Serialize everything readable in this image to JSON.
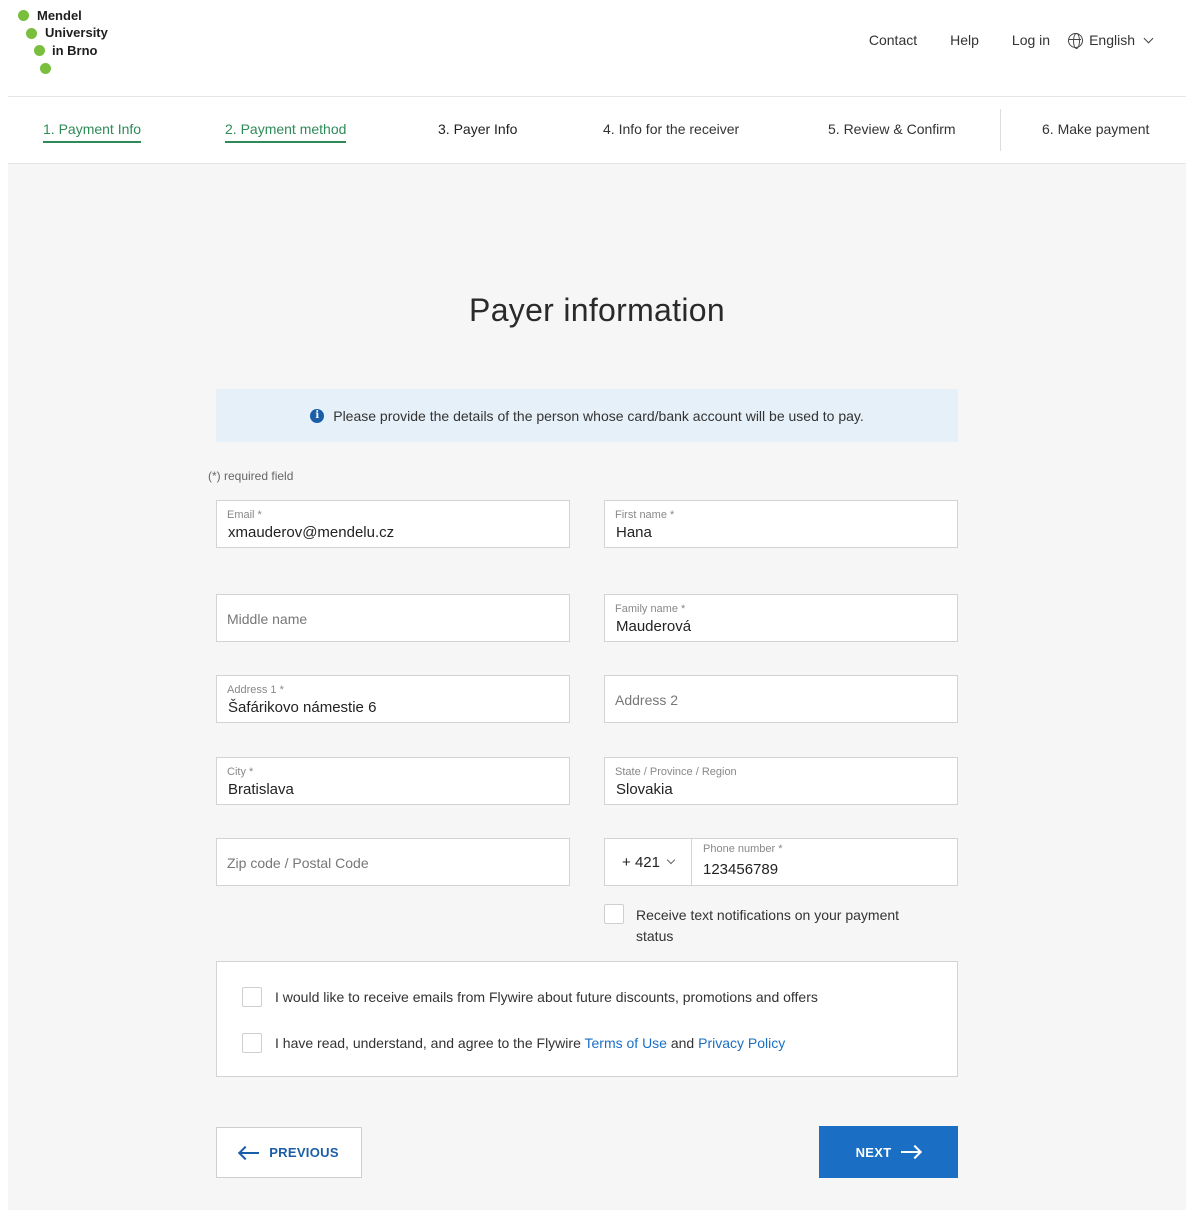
{
  "header": {
    "logo_lines": [
      "Mendel",
      "University",
      "in Brno"
    ],
    "nav": {
      "contact": "Contact",
      "help": "Help",
      "login": "Log in",
      "language": "English"
    }
  },
  "steps": [
    {
      "label": "1. Payment Info",
      "state": "done"
    },
    {
      "label": "2. Payment method",
      "state": "done"
    },
    {
      "label": "3. Payer Info",
      "state": "active"
    },
    {
      "label": "4. Info for the receiver",
      "state": "todo"
    },
    {
      "label": "5. Review & Confirm",
      "state": "todo"
    },
    {
      "label": "6. Make payment",
      "state": "todo"
    }
  ],
  "main": {
    "title": "Payer information",
    "info_banner": "Please provide the details of the person whose card/bank account will be used to pay.",
    "required_note": "(*) required field"
  },
  "form": {
    "email": {
      "label": "Email *",
      "value": "xmauderov@mendelu.cz"
    },
    "first_name": {
      "label": "First name *",
      "value": "Hana"
    },
    "middle_name": {
      "placeholder": "Middle name"
    },
    "family_name": {
      "label": "Family name *",
      "value": "Mauderová"
    },
    "address1": {
      "label": "Address 1 *",
      "value": "Šafárikovo námestie 6"
    },
    "address2": {
      "placeholder": "Address 2"
    },
    "city": {
      "label": "City *",
      "value": "Bratislava"
    },
    "state": {
      "label": "State / Province / Region",
      "value": "Slovakia"
    },
    "zip": {
      "placeholder": "Zip code / Postal Code"
    },
    "phone": {
      "code": "+ 421",
      "label": "Phone number *",
      "value": "123456789"
    },
    "sms_label": "Receive text notifications on your payment status"
  },
  "consent": {
    "marketing": "I would like to receive emails from Flywire about future discounts, promotions and offers",
    "terms_prefix": "I have read, understand, and agree to the Flywire ",
    "terms_link": "Terms of Use",
    "terms_and": " and ",
    "privacy_link": "Privacy Policy"
  },
  "buttons": {
    "previous": "PREVIOUS",
    "next": "NEXT"
  },
  "colors": {
    "brand_green": "#79be3c",
    "step_done": "#2e8b57",
    "primary_blue": "#1a6fc4"
  }
}
